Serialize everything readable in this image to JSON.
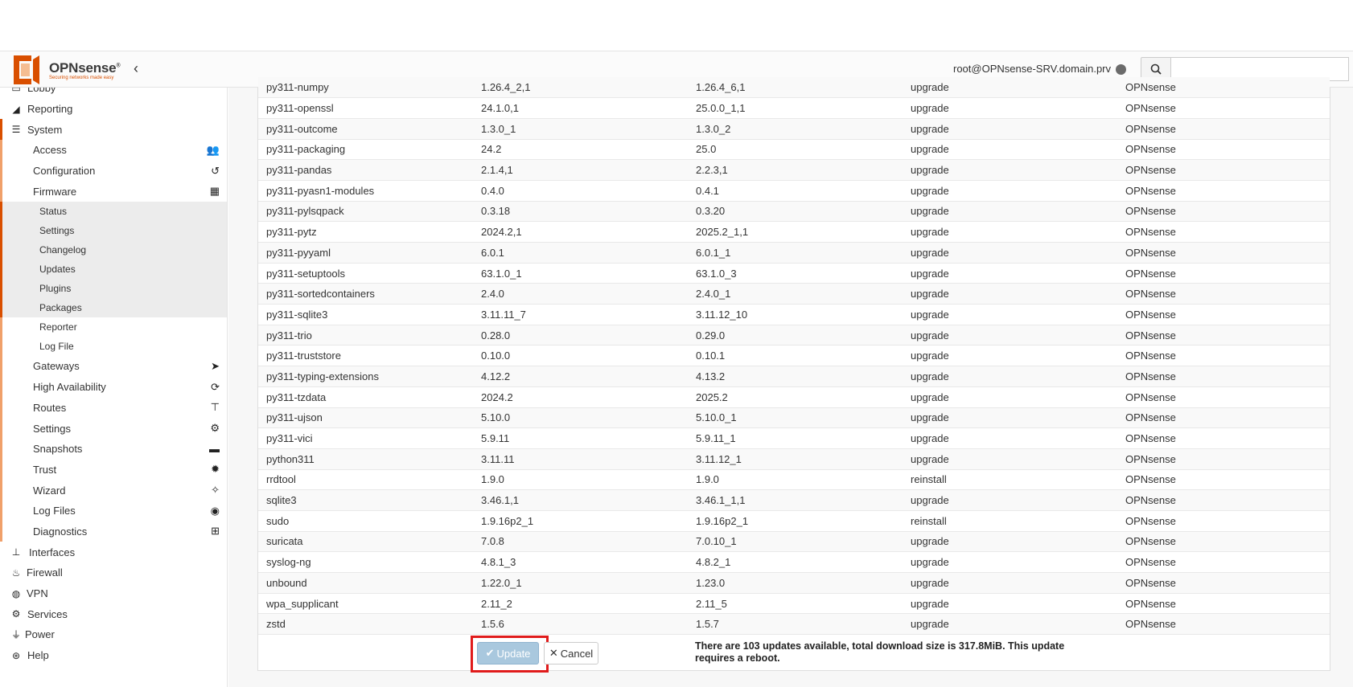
{
  "header": {
    "brand": "OPNsense",
    "brand_mark": "®",
    "tagline": "Securing networks made easy",
    "user": "root@OPNsense-SRV.domain.prv",
    "search_placeholder": ""
  },
  "sidebar": {
    "items": [
      {
        "label": "Lobby",
        "icon": "laptop-icon"
      },
      {
        "label": "Reporting",
        "icon": "area-chart-icon"
      },
      {
        "label": "System",
        "icon": "server-icon"
      },
      {
        "label": "Access",
        "icon": "users-icon"
      },
      {
        "label": "Configuration",
        "icon": "history-icon"
      },
      {
        "label": "Firmware",
        "icon": "building-icon"
      },
      {
        "label": "Status"
      },
      {
        "label": "Settings"
      },
      {
        "label": "Changelog"
      },
      {
        "label": "Updates"
      },
      {
        "label": "Plugins"
      },
      {
        "label": "Packages"
      },
      {
        "label": "Reporter"
      },
      {
        "label": "Log File"
      },
      {
        "label": "Gateways",
        "icon": "location-arrow-icon"
      },
      {
        "label": "High Availability",
        "icon": "refresh-icon"
      },
      {
        "label": "Routes",
        "icon": "map-signs-icon"
      },
      {
        "label": "Settings",
        "icon": "cogs-icon"
      },
      {
        "label": "Snapshots",
        "icon": "hdd-icon"
      },
      {
        "label": "Trust",
        "icon": "certificate-icon"
      },
      {
        "label": "Wizard",
        "icon": "magic-icon"
      },
      {
        "label": "Log Files",
        "icon": "eye-icon"
      },
      {
        "label": "Diagnostics",
        "icon": "medkit-icon"
      },
      {
        "label": "Interfaces",
        "icon": "sitemap-icon"
      },
      {
        "label": "Firewall",
        "icon": "fire-icon"
      },
      {
        "label": "VPN",
        "icon": "globe-icon"
      },
      {
        "label": "Services",
        "icon": "cog-icon"
      },
      {
        "label": "Power",
        "icon": "plug-icon"
      },
      {
        "label": "Help",
        "icon": "life-ring-icon"
      }
    ]
  },
  "packages": [
    [
      "py311-numpy",
      "1.26.4_2,1",
      "1.26.4_6,1",
      "upgrade",
      "OPNsense"
    ],
    [
      "py311-openssl",
      "24.1.0,1",
      "25.0.0_1,1",
      "upgrade",
      "OPNsense"
    ],
    [
      "py311-outcome",
      "1.3.0_1",
      "1.3.0_2",
      "upgrade",
      "OPNsense"
    ],
    [
      "py311-packaging",
      "24.2",
      "25.0",
      "upgrade",
      "OPNsense"
    ],
    [
      "py311-pandas",
      "2.1.4,1",
      "2.2.3,1",
      "upgrade",
      "OPNsense"
    ],
    [
      "py311-pyasn1-modules",
      "0.4.0",
      "0.4.1",
      "upgrade",
      "OPNsense"
    ],
    [
      "py311-pylsqpack",
      "0.3.18",
      "0.3.20",
      "upgrade",
      "OPNsense"
    ],
    [
      "py311-pytz",
      "2024.2,1",
      "2025.2_1,1",
      "upgrade",
      "OPNsense"
    ],
    [
      "py311-pyyaml",
      "6.0.1",
      "6.0.1_1",
      "upgrade",
      "OPNsense"
    ],
    [
      "py311-setuptools",
      "63.1.0_1",
      "63.1.0_3",
      "upgrade",
      "OPNsense"
    ],
    [
      "py311-sortedcontainers",
      "2.4.0",
      "2.4.0_1",
      "upgrade",
      "OPNsense"
    ],
    [
      "py311-sqlite3",
      "3.11.11_7",
      "3.11.12_10",
      "upgrade",
      "OPNsense"
    ],
    [
      "py311-trio",
      "0.28.0",
      "0.29.0",
      "upgrade",
      "OPNsense"
    ],
    [
      "py311-truststore",
      "0.10.0",
      "0.10.1",
      "upgrade",
      "OPNsense"
    ],
    [
      "py311-typing-extensions",
      "4.12.2",
      "4.13.2",
      "upgrade",
      "OPNsense"
    ],
    [
      "py311-tzdata",
      "2024.2",
      "2025.2",
      "upgrade",
      "OPNsense"
    ],
    [
      "py311-ujson",
      "5.10.0",
      "5.10.0_1",
      "upgrade",
      "OPNsense"
    ],
    [
      "py311-vici",
      "5.9.11",
      "5.9.11_1",
      "upgrade",
      "OPNsense"
    ],
    [
      "python311",
      "3.11.11",
      "3.11.12_1",
      "upgrade",
      "OPNsense"
    ],
    [
      "rrdtool",
      "1.9.0",
      "1.9.0",
      "reinstall",
      "OPNsense"
    ],
    [
      "sqlite3",
      "3.46.1,1",
      "3.46.1_1,1",
      "upgrade",
      "OPNsense"
    ],
    [
      "sudo",
      "1.9.16p2_1",
      "1.9.16p2_1",
      "reinstall",
      "OPNsense"
    ],
    [
      "suricata",
      "7.0.8",
      "7.0.10_1",
      "upgrade",
      "OPNsense"
    ],
    [
      "syslog-ng",
      "4.8.1_3",
      "4.8.2_1",
      "upgrade",
      "OPNsense"
    ],
    [
      "unbound",
      "1.22.0_1",
      "1.23.0",
      "upgrade",
      "OPNsense"
    ],
    [
      "wpa_supplicant",
      "2.11_2",
      "2.11_5",
      "upgrade",
      "OPNsense"
    ],
    [
      "zstd",
      "1.5.6",
      "1.5.7",
      "upgrade",
      "OPNsense"
    ]
  ],
  "actions": {
    "update_label": "Update",
    "cancel_label": "Cancel",
    "notice": "There are 103 updates available, total download size is 317.8MiB. This update requires a reboot."
  },
  "colors": {
    "brand": "#d94f00",
    "update_button": "#a9c8de",
    "highlight": "#e01b1b"
  }
}
